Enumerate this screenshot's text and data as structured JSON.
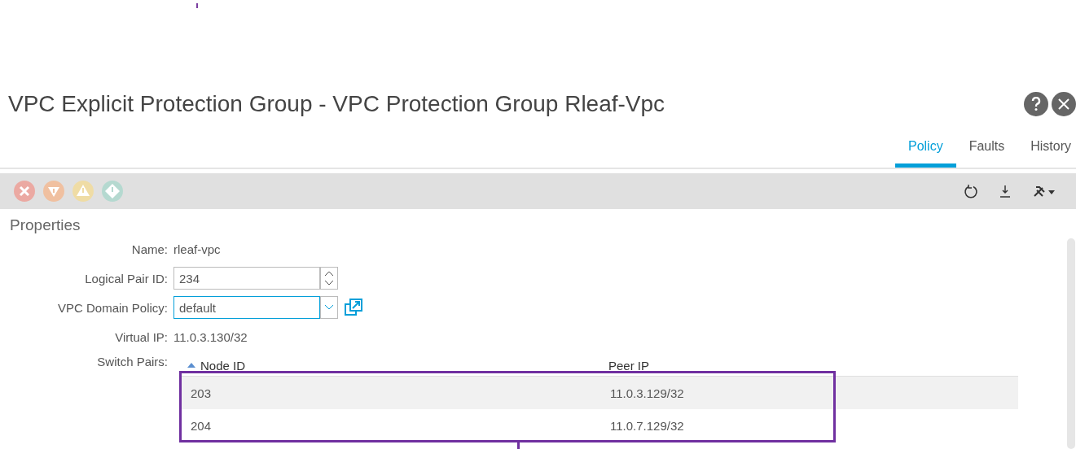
{
  "window": {
    "title": "VPC Explicit Protection Group - VPC Protection Group Rleaf-Vpc"
  },
  "tabs": [
    {
      "label": "Policy",
      "selected": true
    },
    {
      "label": "Faults",
      "selected": false
    },
    {
      "label": "History",
      "selected": false
    }
  ],
  "section": {
    "title": "Properties"
  },
  "fields": [
    {
      "kind": "text",
      "label": "Name:",
      "value": "rleaf-vpc"
    },
    {
      "kind": "spinner",
      "label": "Logical Pair ID:",
      "value": "234"
    },
    {
      "kind": "select",
      "label": "VPC Domain Policy:",
      "value": "default"
    },
    {
      "kind": "text",
      "label": "Virtual IP:",
      "value": "11.0.3.130/32"
    }
  ],
  "switch_pairs": {
    "label": "Switch Pairs:",
    "columns": [
      {
        "label": "Node ID",
        "sorted": true
      },
      {
        "label": "Peer IP",
        "sorted": false
      }
    ],
    "rows": [
      [
        "203",
        "11.0.3.129/32"
      ],
      [
        "204",
        "11.0.7.129/32"
      ]
    ]
  }
}
